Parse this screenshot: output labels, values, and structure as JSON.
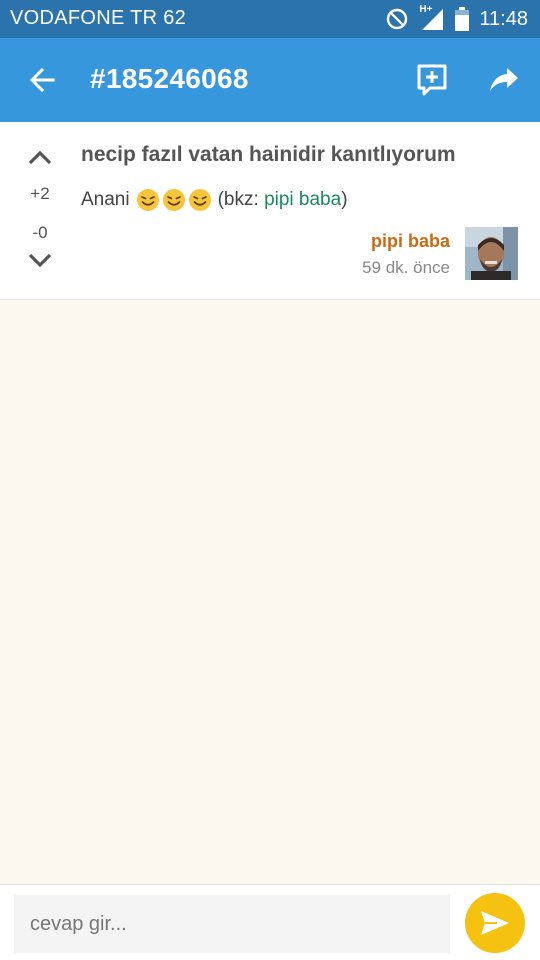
{
  "status_bar": {
    "carrier": "VODAFONE TR 62",
    "network": "H+",
    "time": "11:48"
  },
  "app_bar": {
    "title": "#185246068",
    "icons": [
      "back-arrow-icon",
      "add-comment-icon",
      "share-icon"
    ]
  },
  "entry": {
    "topic": "necip fazıl vatan hainidir kanıtlıyorum",
    "body_prefix": "Anani",
    "emoji_count": 3,
    "bkz_prefix": "(bkz: ",
    "bkz_link": "pipi baba",
    "bkz_suffix": ")",
    "upvotes": "+2",
    "downvotes": "-0",
    "author": "pipi baba",
    "time_ago": "59 dk. önce"
  },
  "reply": {
    "placeholder": "cevap gir..."
  },
  "colors": {
    "status_bar": "#2a73ad",
    "app_bar": "#3697dc",
    "background": "#fbf8f0",
    "author": "#cc6a14",
    "link": "#188a5e",
    "send_button": "#f5c211"
  }
}
